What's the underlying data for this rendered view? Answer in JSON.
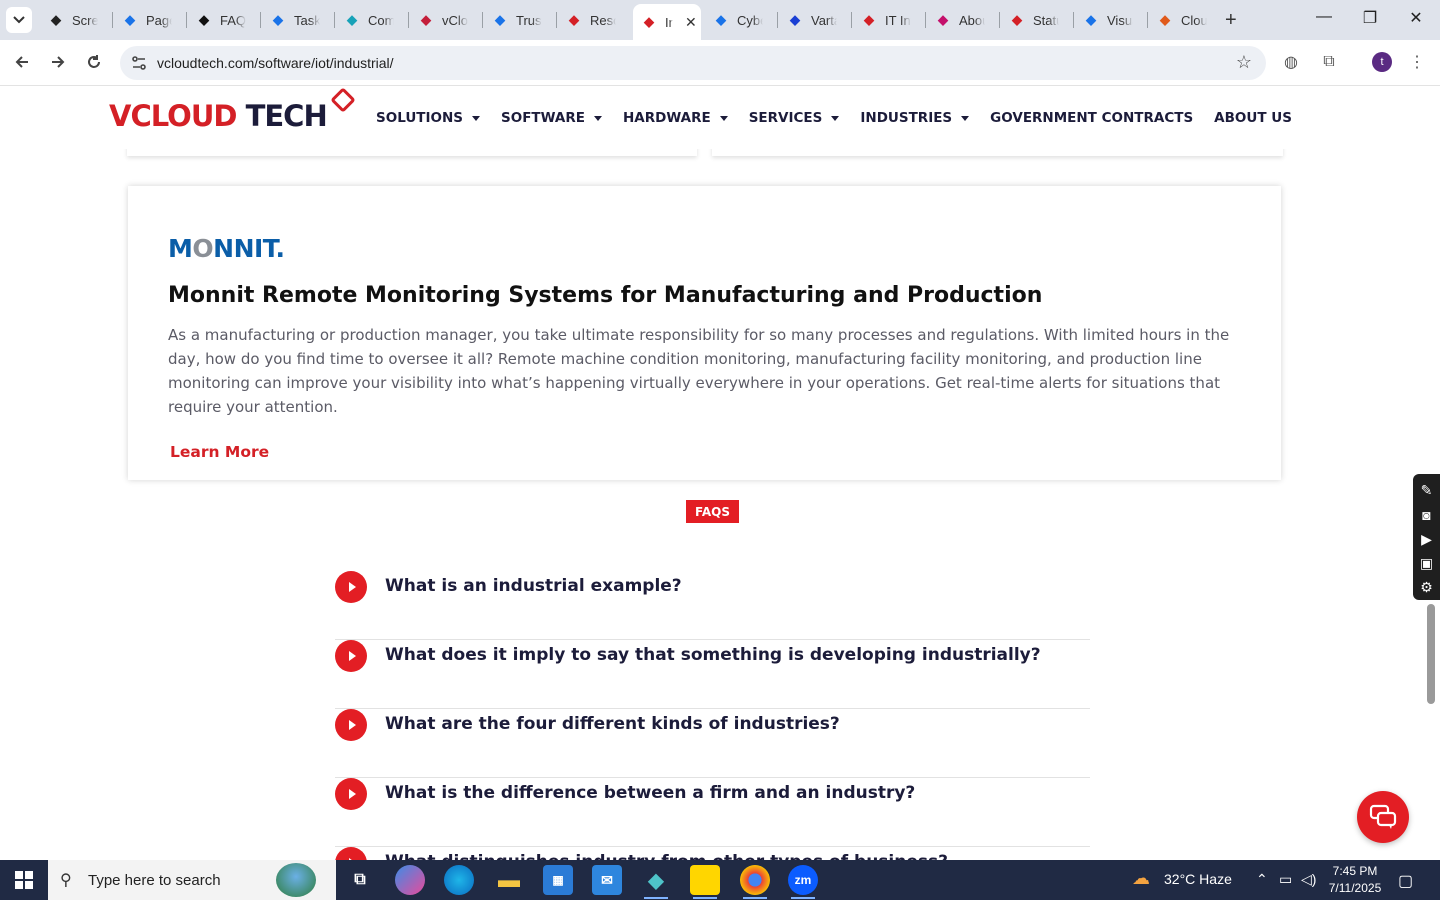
{
  "browser": {
    "tabs": [
      {
        "title": "Screenshot",
        "icon": "screencast-icon",
        "color": "#222"
      },
      {
        "title": "PageSpeed",
        "icon": "pagespeed-icon",
        "color": "#1a73e8"
      },
      {
        "title": "FAQ",
        "icon": "faq-icon",
        "color": "#111"
      },
      {
        "title": "Tasks",
        "icon": "tasks-icon",
        "color": "#1a73e8"
      },
      {
        "title": "Comments",
        "icon": "comments-icon",
        "color": "#17a2b8"
      },
      {
        "title": "vCloud",
        "icon": "vcloud-icon",
        "color": "#c41e3a"
      },
      {
        "title": "Trust",
        "icon": "scale-icon",
        "color": "#1a73e8"
      },
      {
        "title": "Resources",
        "icon": "vcloud-diamond-icon",
        "color": "#d42026"
      },
      {
        "title": "Industrial",
        "icon": "vcloud-diamond-icon",
        "color": "#d42026",
        "active": true
      },
      {
        "title": "Cyber",
        "icon": "check-icon",
        "color": "#1a73e8"
      },
      {
        "title": "Varta",
        "icon": "x-icon",
        "color": "#1a3fd4"
      },
      {
        "title": "IT Info",
        "icon": "vcloud-diamond-icon",
        "color": "#d42026"
      },
      {
        "title": "About",
        "icon": "about-icon",
        "color": "#c4106b"
      },
      {
        "title": "Status",
        "icon": "status-icon",
        "color": "#d42026"
      },
      {
        "title": "Visual",
        "icon": "pulse-icon",
        "color": "#1a73e8"
      },
      {
        "title": "Cloud",
        "icon": "cloud-slash-icon",
        "color": "#e05a1b"
      }
    ],
    "url": "vcloudtech.com/software/iot/industrial/",
    "profile_initial": "t"
  },
  "site": {
    "logo": {
      "v": "V",
      "cloud": "CLOUD",
      "tech": " TECH"
    },
    "nav": [
      {
        "label": "SOLUTIONS",
        "caret": true
      },
      {
        "label": "SOFTWARE",
        "caret": true
      },
      {
        "label": "HARDWARE",
        "caret": true
      },
      {
        "label": "SERVICES",
        "caret": true
      },
      {
        "label": "INDUSTRIES",
        "caret": true
      },
      {
        "label": "GOVERNMENT CONTRACTS",
        "caret": false
      },
      {
        "label": "ABOUT US",
        "caret": false
      }
    ]
  },
  "card": {
    "brand": {
      "pre": "M",
      "o": "O",
      "post": "NNIT."
    },
    "title": "Monnit Remote Monitoring Systems for Manufacturing and Production",
    "body": "As a manufacturing or production manager, you take ultimate responsibility for so many processes and regulations. With limited hours in the day, how do you find time to oversee it all? Remote machine condition monitoring, manufacturing facility monitoring, and production line monitoring can improve your visibility into what’s happening virtually everywhere in your operations. Get real-time alerts for situations that require your attention.",
    "cta": "Learn More"
  },
  "faq": {
    "badge": "FAQS",
    "items": [
      "What is an industrial example?",
      "What does it imply to say that something is developing industrially?",
      "What are the four different kinds of industries?",
      "What is the difference between a firm and an industry?",
      "What distinguishes industry from other types of business?"
    ]
  },
  "taskbar": {
    "search_placeholder": "Type here to search",
    "weather": "32°C  Haze",
    "time": "7:45 PM",
    "date": "7/11/2025"
  }
}
